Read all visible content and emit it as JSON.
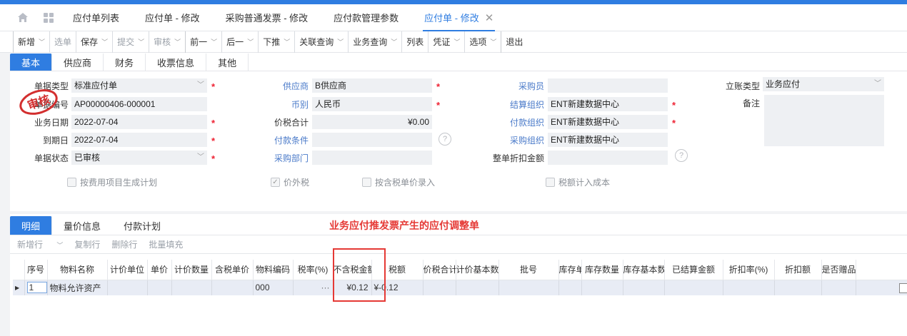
{
  "tabs": [
    {
      "label": "应付单列表"
    },
    {
      "label": "应付单 - 修改"
    },
    {
      "label": "采购普通发票 - 修改"
    },
    {
      "label": "应付款管理参数"
    },
    {
      "label": "应付单 - 修改",
      "active": true
    }
  ],
  "toolbar": {
    "new": "新增",
    "select": "选单",
    "save": "保存",
    "submit": "提交",
    "audit": "审核",
    "prev": "前一",
    "next": "后一",
    "push": "下推",
    "related_query": "关联查询",
    "biz_query": "业务查询",
    "list": "列表",
    "voucher": "凭证",
    "options": "选项",
    "exit": "退出"
  },
  "form_tabs": [
    "基本",
    "供应商",
    "财务",
    "收票信息",
    "其他"
  ],
  "form": {
    "doc_type_label": "单据类型",
    "doc_type": "标准应付单",
    "doc_no_label": "单据编号",
    "doc_no": "AP00000406-000001",
    "biz_date_label": "业务日期",
    "biz_date": "2022-07-04",
    "due_date_label": "到期日",
    "due_date": "2022-07-04",
    "status_label": "单据状态",
    "status": "已审核",
    "supplier_label": "供应商",
    "supplier": "B供应商",
    "currency_label": "币别",
    "currency": "人民币",
    "total_label": "价税合计",
    "total": "¥0.00",
    "pay_terms_label": "付款条件",
    "pay_terms": "",
    "purchase_dept_label": "采购部门",
    "purchase_dept": "",
    "buyer_label": "采购员",
    "buyer": "",
    "settle_org_label": "结算组织",
    "settle_org": "ENT新建数据中心",
    "pay_org_label": "付款组织",
    "pay_org": "ENT新建数据中心",
    "purchase_org_label": "采购组织",
    "purchase_org": "ENT新建数据中心",
    "discount_label": "整单折扣金额",
    "discount": "",
    "account_type_label": "立账类型",
    "account_type": "业务应付",
    "remark_label": "备注",
    "stamp_text": "审核"
  },
  "checkboxes": {
    "gen_plan": "按费用项目生成计划",
    "tax_excl": "价外税",
    "tax_incl_price": "按含税单价录入",
    "tax_cost": "税额计入成本"
  },
  "detail_tabs": [
    "明细",
    "量价信息",
    "付款计划"
  ],
  "annotation": "业务应付推发票产生的应付调整单",
  "grid_toolbar": [
    "新增行",
    "复制行",
    "删除行",
    "批量填充"
  ],
  "grid": {
    "columns": [
      "序号",
      "物料名称",
      "计价单位",
      "单价",
      "计价数量",
      "含税单价",
      "物料编码",
      "税率(%)",
      "不含税金额",
      "税额",
      "价税合计",
      "计价基本数量",
      "批号",
      "库存单位",
      "库存数量",
      "库存基本数量",
      "已结算金额",
      "折扣率(%)",
      "折扣额",
      "是否赠品"
    ],
    "rows": [
      {
        "seq": "1",
        "material_name": "物料允许资产",
        "unit": "",
        "price": "",
        "qty": "",
        "tax_price": "",
        "material_code": "000",
        "tax_rate": "···",
        "amount_excl": "¥0.12",
        "tax": "¥-0.12",
        "total": ""
      }
    ]
  }
}
